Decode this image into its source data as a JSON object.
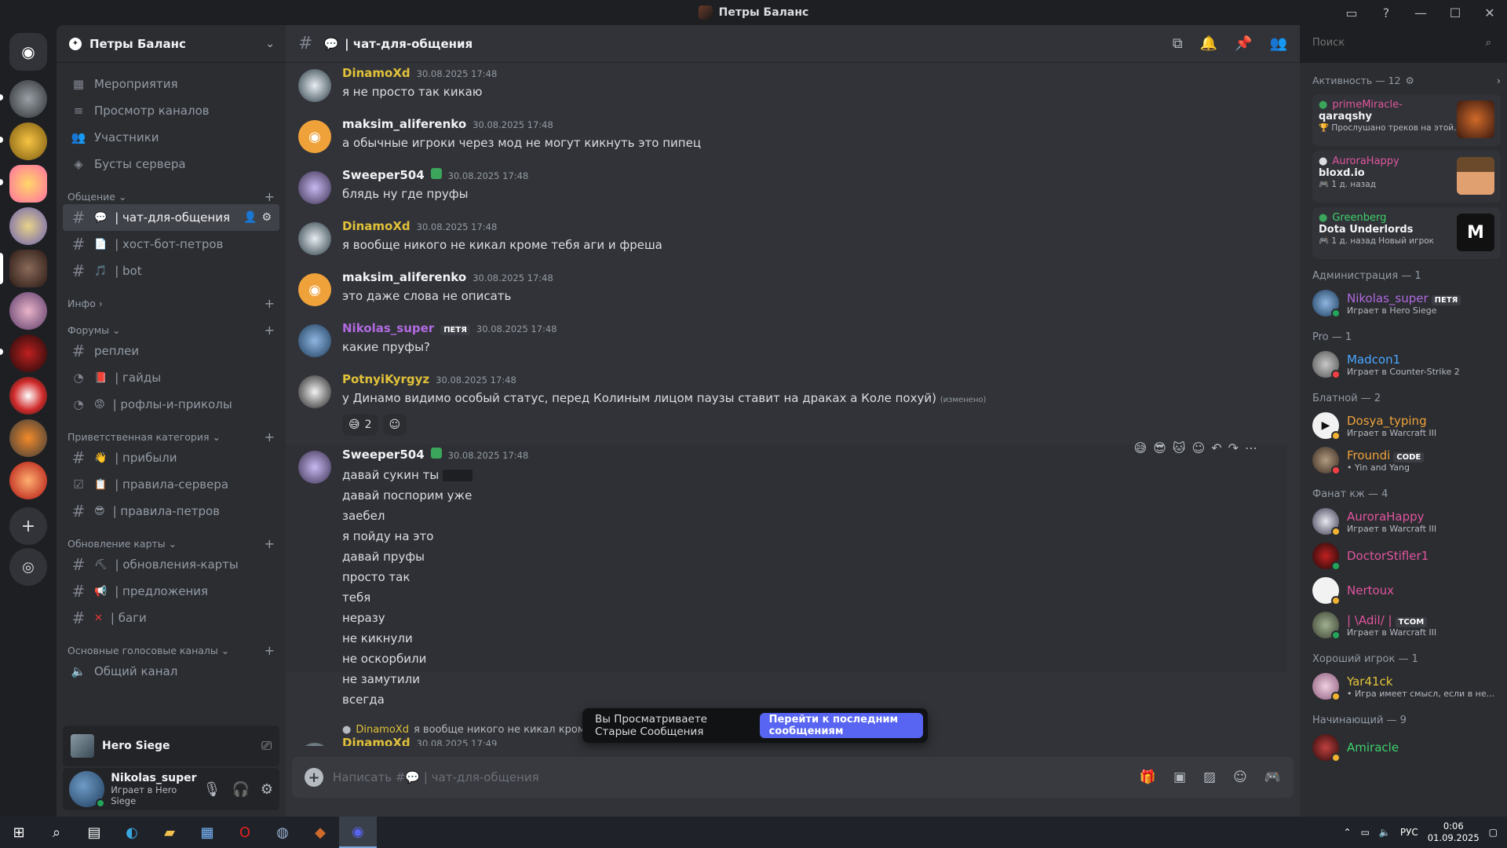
{
  "window": {
    "title": "Петры Баланс"
  },
  "guild": {
    "name": "Петры Баланс"
  },
  "sidebar": {
    "top_items": [
      {
        "label": "Мероприятия"
      },
      {
        "label": "Просмотр каналов"
      },
      {
        "label": "Участники"
      },
      {
        "label": "Бусты сервера"
      }
    ],
    "cat_obshchenie": "Общение",
    "ch_chat": "| чат-для-общения",
    "ch_host": "| хост-бот-петров",
    "ch_bot": "| bot",
    "cat_info": "Инфо",
    "cat_forums": "Форумы",
    "ch_replei": "реплеи",
    "ch_gaidy": "| гайды",
    "ch_rofly": "| рофлы-и-приколы",
    "cat_welcome": "Приветственная категория",
    "ch_pribyli": "| прибыли",
    "ch_pravila_servera": "| правила-сервера",
    "ch_pravila_petrov": "| правила-петров",
    "cat_update": "Обновление карты",
    "ch_obnovleniya": "| обновления-карты",
    "ch_predlozheniya": "| предложения",
    "ch_bagi": "| баги",
    "cat_voice": "Основные голосовые каналы",
    "ch_obshchiy": "Общий канал"
  },
  "voice_bar": {
    "name": "Hero Siege"
  },
  "user_panel": {
    "name": "Nikolas_super",
    "status": "Играет в Hero Siege"
  },
  "chat": {
    "channel_name": "| чат-для-общения",
    "messages": [
      {
        "author": "DinamoXd",
        "time": "30.08.2025 17:48",
        "text": "я не просто так кикаю"
      },
      {
        "author": "maksim_aliferenko",
        "time": "30.08.2025 17:48",
        "text": "а обычные игроки через мод не могут кикнуть это пипец"
      },
      {
        "author": "Sweeper504",
        "time": "30.08.2025 17:48",
        "text": "блядь ну где пруфы"
      },
      {
        "author": "DinamoXd",
        "time": "30.08.2025 17:48",
        "text": "я вообще никого не кикал кроме тебя аги и фреша"
      },
      {
        "author": "maksim_aliferenko",
        "time": "30.08.2025 17:48",
        "text": "это даже слова не описать"
      },
      {
        "author": "Nikolas_super",
        "badge": "ПЕТЯ",
        "time": "30.08.2025 17:48",
        "text": "какие пруфы?"
      },
      {
        "author": "PotnyiKyrgyz",
        "time": "30.08.2025 17:48",
        "text": "у Динамо видимо особый статус, перед Колиным лицом паузы ставит на драках а Коле похуй)",
        "edited": "(изменено)",
        "reaction_count": "2"
      },
      {
        "author": "Sweeper504",
        "time": "30.08.2025 17:48",
        "lines": [
          "давай сукин ты",
          "давай поспорим уже",
          "заебел",
          "я пойду на это",
          "давай пруфы",
          "просто так",
          "тебя",
          "неразу",
          "не кикнули",
          "не оскорбили",
          "не замутили",
          "всегда"
        ]
      },
      {
        "author": "DinamoXd",
        "time": "30.08.2025 17:49",
        "reply_author": "DinamoXd",
        "reply_text": "я вообще никого не кикал кроме те"
      }
    ],
    "old_banner": "Вы Просматриваете Старые Сообщения",
    "jump_button": "Перейти к последним сообщениям",
    "composer_placeholder_prefix": "Написать #",
    "composer_placeholder_channel": "| чат-для-общения"
  },
  "search": {
    "placeholder": "Поиск"
  },
  "members": {
    "activity_title": "Активность — 12",
    "activities": [
      {
        "user": "primeMiracle-",
        "title": "qaraqshy",
        "sub": "Прослушано треков на этой..."
      },
      {
        "user": "AuroraHappy",
        "title": "bloxd.io",
        "sub": "1 д. назад"
      },
      {
        "user": "Greenberg",
        "title": "Dota Underlords",
        "sub": "1 д. назад",
        "sub2": "Новый игрок"
      }
    ],
    "groups": [
      {
        "title": "Администрация — 1",
        "members": [
          {
            "name": "Nikolas_super",
            "tag": "ПЕТЯ",
            "status": "Играет в Hero Siege",
            "color": "#b16ae0"
          }
        ]
      },
      {
        "title": "Pro — 1",
        "members": [
          {
            "name": "Madcon1",
            "status": "Играет в Counter-Strike 2",
            "color": "#4aa8ff"
          }
        ]
      },
      {
        "title": "Блатной — 2",
        "members": [
          {
            "name": "Dosya_typing",
            "status": "Играет в Warcraft III",
            "color": "#f0a23a"
          },
          {
            "name": "Froundi",
            "tag": "CODE",
            "status": "• Yin and Yang",
            "color": "#f0a23a"
          }
        ]
      },
      {
        "title": "Фанат кж — 4",
        "members": [
          {
            "name": "AuroraHappy",
            "status": "Играет в Warcraft III",
            "color": "#e0559e"
          },
          {
            "name": "DoctorStifler1",
            "status": "",
            "color": "#e0559e"
          },
          {
            "name": "Nertoux",
            "status": "",
            "color": "#e0559e"
          },
          {
            "name": "| \\Adil/ |",
            "tag": "TCOM",
            "status": "Играет в Warcraft III",
            "color": "#e0559e"
          }
        ]
      },
      {
        "title": "Хороший игрок — 1",
        "members": [
          {
            "name": "Yar41ck",
            "status": "• Игра имеет смысл, если в не...",
            "color": "#e2c23a"
          }
        ]
      },
      {
        "title": "Начинающий — 9",
        "members": [
          {
            "name": "Amiracle",
            "status": "",
            "color": "#3ed26d"
          }
        ]
      }
    ]
  },
  "taskbar": {
    "lang": "РУС",
    "time": "0:06",
    "date": "01.09.2025"
  }
}
